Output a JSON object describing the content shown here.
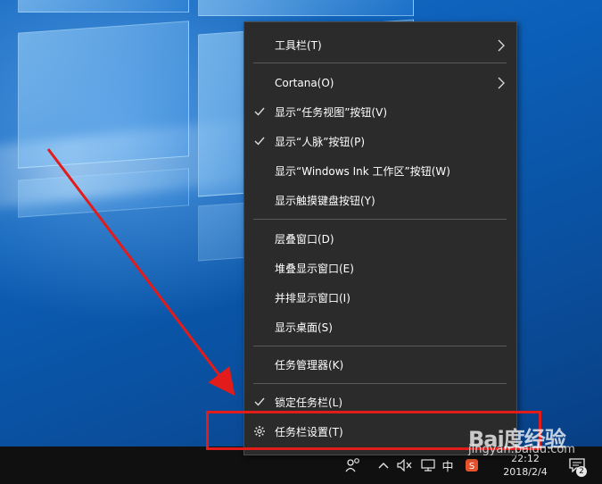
{
  "menu": {
    "items": [
      {
        "label": "工具栏(T)",
        "submenu": true
      },
      {
        "label": "Cortana(O)",
        "submenu": true
      },
      {
        "label": "显示“任务视图”按钮(V)",
        "checked": true
      },
      {
        "label": "显示“人脉”按钮(P)",
        "checked": true
      },
      {
        "label": "显示“Windows Ink 工作区”按钮(W)"
      },
      {
        "label": "显示触摸键盘按钮(Y)"
      },
      {
        "label": "层叠窗口(D)"
      },
      {
        "label": "堆叠显示窗口(E)"
      },
      {
        "label": "并排显示窗口(I)"
      },
      {
        "label": "显示桌面(S)"
      },
      {
        "label": "任务管理器(K)"
      },
      {
        "label": "锁定任务栏(L)",
        "checked": true
      },
      {
        "label": "任务栏设置(T)",
        "icon": "gear-icon"
      }
    ]
  },
  "taskbar": {
    "ime": "中",
    "time": "22:12",
    "date": "2018/2/4",
    "notification_count": "2"
  },
  "watermark": {
    "logo": "Bai度经验",
    "url": "jingyan.baidu.com"
  },
  "colors": {
    "menu_bg": "#2b2b2b",
    "highlight": "#e21b1b",
    "taskbar_bg": "#101010"
  }
}
